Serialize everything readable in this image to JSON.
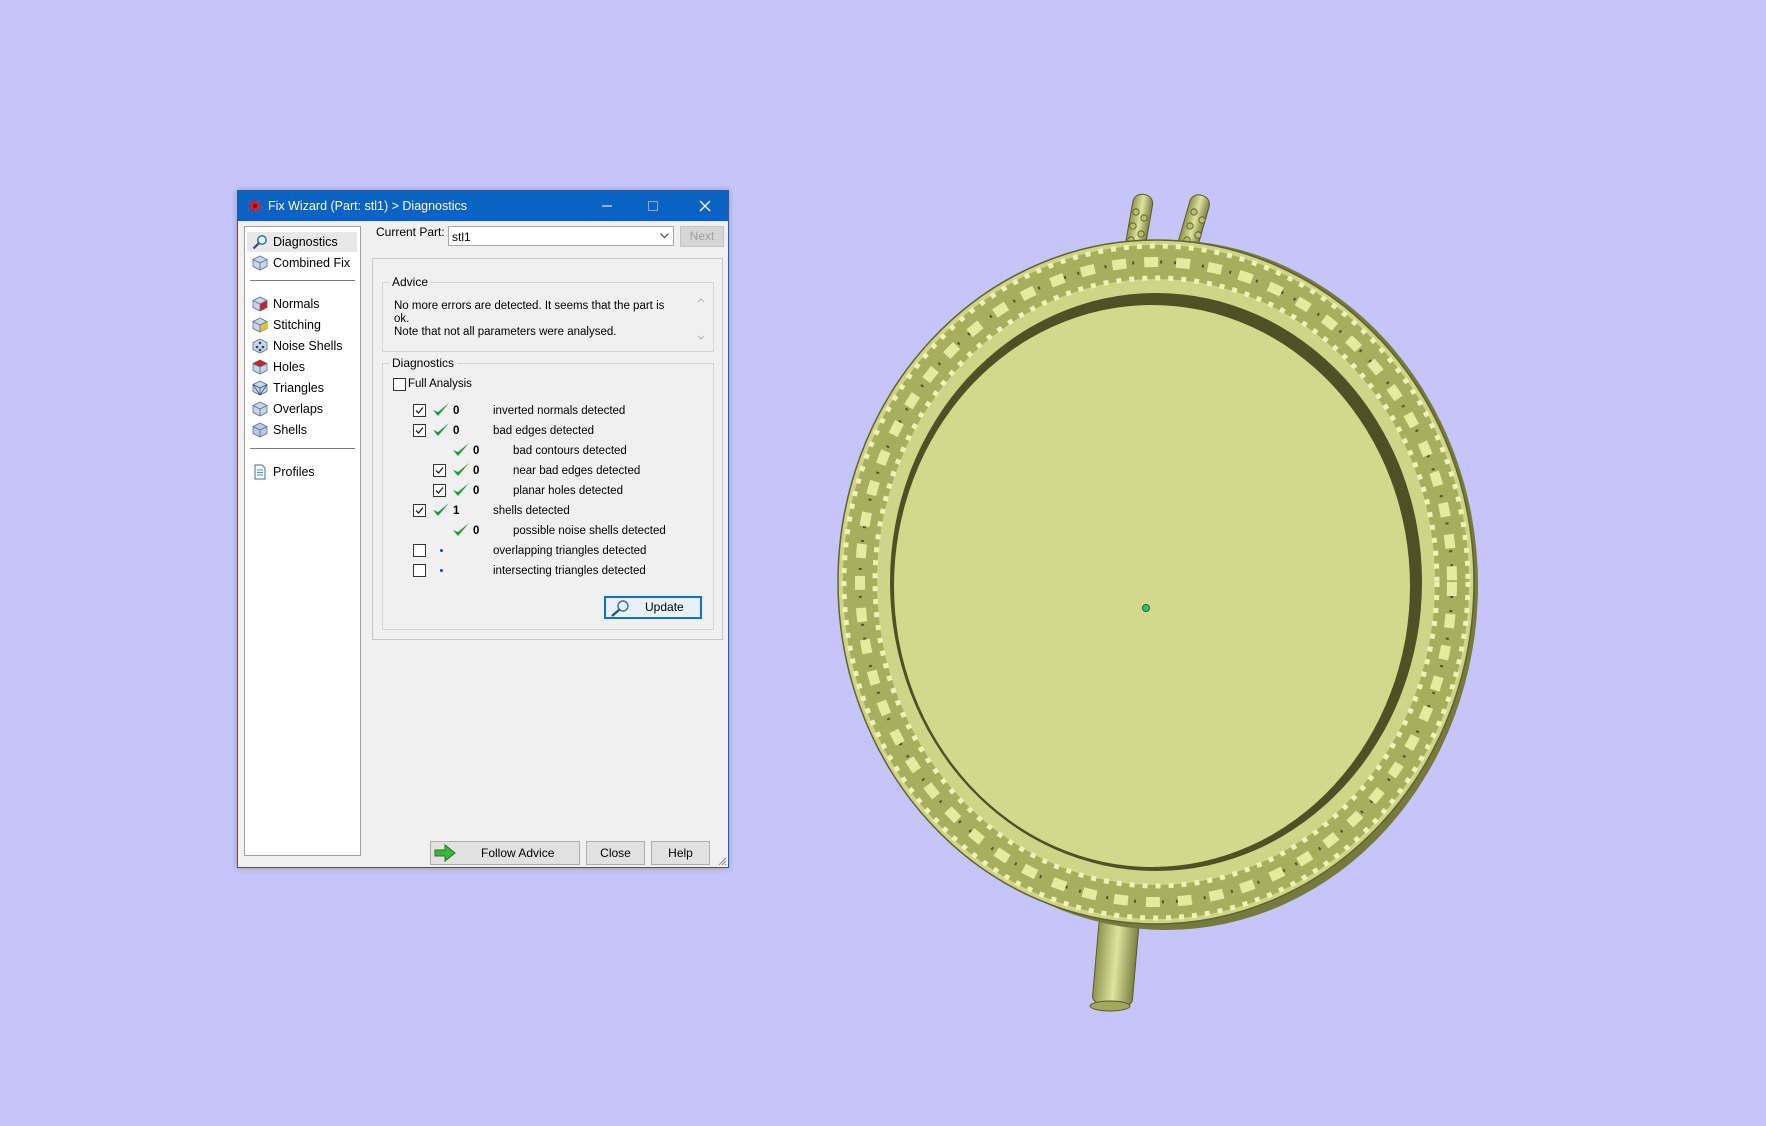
{
  "window": {
    "title": "Fix Wizard (Part: stl1) > Diagnostics"
  },
  "nav": {
    "items": [
      {
        "label": "Diagnostics",
        "icon": "magnifier-icon",
        "selected": true
      },
      {
        "label": "Combined Fix",
        "icon": "cube-icon"
      },
      {
        "label": "Normals",
        "icon": "cube-red-icon"
      },
      {
        "label": "Stitching",
        "icon": "cube-yellow-icon"
      },
      {
        "label": "Noise Shells",
        "icon": "cube-dots-icon"
      },
      {
        "label": "Holes",
        "icon": "cube-red-icon"
      },
      {
        "label": "Triangles",
        "icon": "cube-triangles-icon"
      },
      {
        "label": "Overlaps",
        "icon": "cube-icon"
      },
      {
        "label": "Shells",
        "icon": "cube-icon"
      },
      {
        "label": "Profiles",
        "icon": "document-icon"
      }
    ]
  },
  "part": {
    "label": "Current Part:",
    "value": "stl1",
    "next_label": "Next"
  },
  "advice": {
    "title": "Advice",
    "line1": "No more errors are detected. It seems that the part is ok.",
    "line2": "Note that not all parameters were analysed."
  },
  "diagnostics": {
    "title": "Diagnostics",
    "full_analysis_label": "Full Analysis",
    "full_analysis_checked": false,
    "rows": [
      {
        "label": "inverted normals detected",
        "value": "0",
        "checked": true,
        "status": "ok"
      },
      {
        "label": "bad edges detected",
        "value": "0",
        "checked": true,
        "status": "ok"
      },
      {
        "label": "bad contours detected",
        "value": "0",
        "status": "ok"
      },
      {
        "label": "near bad edges detected",
        "value": "0",
        "checked": true,
        "status": "ok"
      },
      {
        "label": "planar holes detected",
        "value": "0",
        "checked": true,
        "status": "ok"
      },
      {
        "label": "shells detected",
        "value": "1",
        "checked": true,
        "status": "ok"
      },
      {
        "label": "possible noise shells detected",
        "value": "0",
        "status": "ok"
      },
      {
        "label": "overlapping triangles detected",
        "checked": false,
        "status": "not-analysed"
      },
      {
        "label": "intersecting triangles detected",
        "checked": false,
        "status": "not-analysed"
      }
    ],
    "update_label": "Update"
  },
  "footer": {
    "follow_label": "Follow Advice",
    "close_label": "Close",
    "help_label": "Help"
  },
  "colors": {
    "background": "#c6c5fa",
    "titlebar": "#0a63c2",
    "model": "#d3d88b",
    "model_shadow": "#7f8344",
    "ok_tick": "#1f9a3b"
  }
}
